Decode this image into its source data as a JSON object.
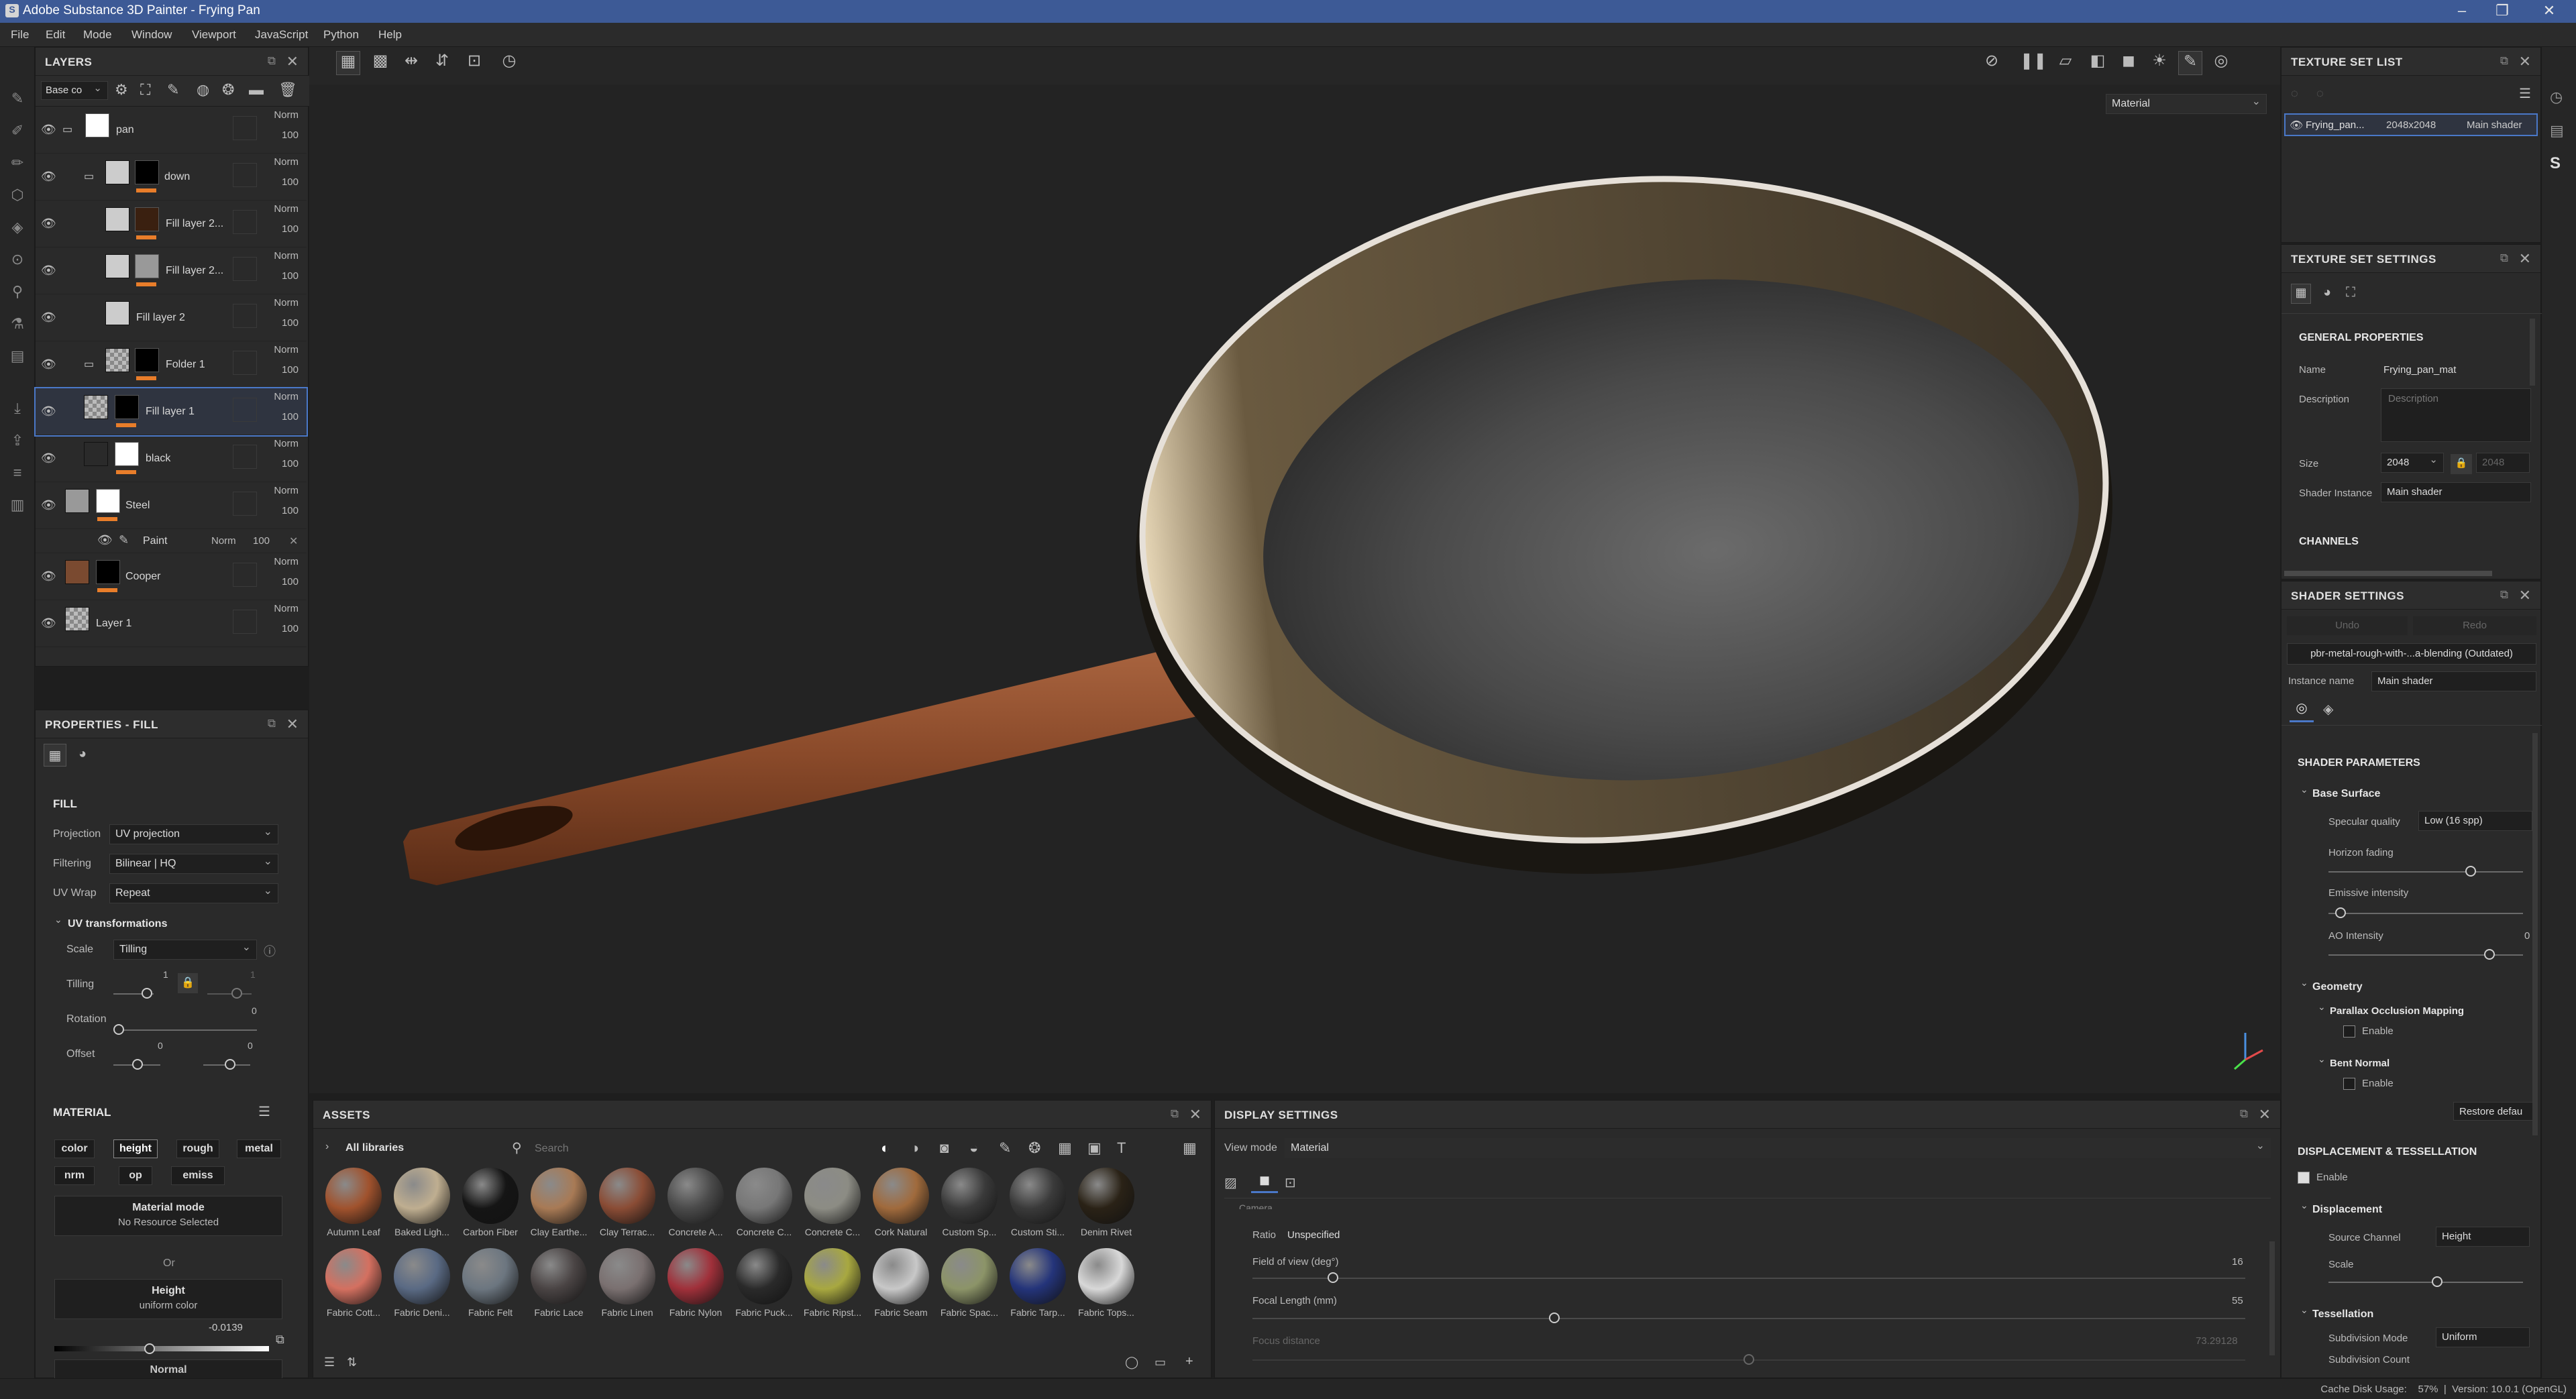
{
  "window": {
    "title": "Adobe Substance 3D Painter - Frying Pan"
  },
  "menu": [
    "File",
    "Edit",
    "Mode",
    "Window",
    "Viewport",
    "JavaScript",
    "Python",
    "Help"
  ],
  "layers": {
    "title": "LAYERS",
    "channel_select": "Base co",
    "items": [
      {
        "name": "pan",
        "blend": "Norm",
        "opacity": "100"
      },
      {
        "name": "down",
        "blend": "Norm",
        "opacity": "100"
      },
      {
        "name": "Fill layer 2...",
        "blend": "Norm",
        "opacity": "100"
      },
      {
        "name": "Fill layer 2...",
        "blend": "Norm",
        "opacity": "100"
      },
      {
        "name": "Fill layer 2",
        "blend": "Norm",
        "opacity": "100"
      },
      {
        "name": "Folder 1",
        "blend": "Norm",
        "opacity": "100"
      },
      {
        "name": "Fill layer 1",
        "blend": "Norm",
        "opacity": "100"
      },
      {
        "name": "black",
        "blend": "Norm",
        "opacity": "100"
      },
      {
        "name": "Steel",
        "blend": "Norm",
        "opacity": "100"
      },
      {
        "name": "Cooper",
        "blend": "Norm",
        "opacity": "100"
      },
      {
        "name": "Layer 1",
        "blend": "Norm",
        "opacity": "100"
      }
    ],
    "effect": {
      "name": "Paint",
      "blend": "Norm",
      "opacity": "100"
    }
  },
  "properties": {
    "title": "PROPERTIES - FILL",
    "section": "FILL",
    "projection_label": "Projection",
    "projection": "UV projection",
    "filtering_label": "Filtering",
    "filtering": "Bilinear | HQ",
    "uvwrap_label": "UV Wrap",
    "uvwrap": "Repeat",
    "uvtrans": "UV transformations",
    "scale_label": "Scale",
    "scale": "Tilling",
    "tilling_label": "Tilling",
    "tilling_v1": "1",
    "tilling_v2": "1",
    "rotation_label": "Rotation",
    "rotation_v": "0",
    "offset_label": "Offset",
    "offset_v1": "0",
    "offset_v2": "0",
    "material_title": "MATERIAL",
    "chips": [
      "color",
      "height",
      "rough",
      "metal",
      "nrm",
      "op",
      "emiss"
    ],
    "material_mode": "Material mode",
    "no_resource": "No Resource Selected",
    "or": "Or",
    "height": "Height",
    "uniform": "uniform color",
    "height_value": "-0.0139",
    "normal": "Normal"
  },
  "viewport": {
    "mode": "Material"
  },
  "assets": {
    "title": "ASSETS",
    "library": "All libraries",
    "search_placeholder": "Search",
    "row1": [
      {
        "name": "Autumn Leaf",
        "color": "#a0522d"
      },
      {
        "name": "Baked Ligh...",
        "color": "#bfae90"
      },
      {
        "name": "Carbon Fiber",
        "color": "#151515"
      },
      {
        "name": "Clay Earthe...",
        "color": "#a87a55"
      },
      {
        "name": "Clay Terrac...",
        "color": "#8a4c35"
      },
      {
        "name": "Concrete A...",
        "color": "#4a4a4a"
      },
      {
        "name": "Concrete C...",
        "color": "#777"
      },
      {
        "name": "Concrete C...",
        "color": "#8c8c84"
      },
      {
        "name": "Cork Natural",
        "color": "#a06a3c"
      },
      {
        "name": "Custom Sp...",
        "color": "#3a3a3a"
      },
      {
        "name": "Custom Sti...",
        "color": "#3a3a3a"
      },
      {
        "name": "Denim Rivet",
        "color": "#2a2216"
      }
    ],
    "row2": [
      {
        "name": "Fabric Cott...",
        "color": "#d47060"
      },
      {
        "name": "Fabric Deni...",
        "color": "#5a6a84"
      },
      {
        "name": "Fabric Felt",
        "color": "#6c7680"
      },
      {
        "name": "Fabric Lace",
        "color": "#4a4444"
      },
      {
        "name": "Fabric Linen",
        "color": "#7a7070"
      },
      {
        "name": "Fabric Nylon",
        "color": "#a0303a"
      },
      {
        "name": "Fabric Puck...",
        "color": "#2a2a2a"
      },
      {
        "name": "Fabric Ripst...",
        "color": "#a8a840"
      },
      {
        "name": "Fabric Seam",
        "color": "#c8c8c8"
      },
      {
        "name": "Fabric Spac...",
        "color": "#8c9468"
      },
      {
        "name": "Fabric Tarp...",
        "color": "#24347a"
      },
      {
        "name": "Fabric Tops...",
        "color": "#d8d8d8"
      }
    ]
  },
  "display": {
    "title": "DISPLAY SETTINGS",
    "view_mode_label": "View mode",
    "view_mode": "Material",
    "camera": "Camera",
    "ratio_label": "Ratio",
    "ratio": "Unspecified",
    "fov_label": "Field of view (deg°)",
    "fov": "16",
    "focal_label": "Focal Length (mm)",
    "focal": "55",
    "focus_label": "Focus distance",
    "focus": "73.29128"
  },
  "texture_set_list": {
    "title": "TEXTURE SET LIST",
    "name": "Frying_pan...",
    "res": "2048x2048",
    "shader": "Main shader"
  },
  "texture_set_settings": {
    "title": "TEXTURE SET SETTINGS",
    "general": "GENERAL PROPERTIES",
    "name_label": "Name",
    "name": "Frying_pan_mat",
    "desc_label": "Description",
    "desc_placeholder": "Description",
    "size_label": "Size",
    "size": "2048",
    "size2": "2048",
    "shader_label": "Shader Instance",
    "shader": "Main shader",
    "channels": "CHANNELS"
  },
  "shader_settings": {
    "title": "SHADER SETTINGS",
    "undo": "Undo",
    "redo": "Redo",
    "shader_name": "pbr-metal-rough-with-...a-blending (Outdated)",
    "instance_label": "Instance name",
    "instance": "Main shader",
    "params": "SHADER PARAMETERS",
    "base_surface": "Base Surface",
    "spec_label": "Specular quality",
    "spec": "Low (16 spp)",
    "horizon": "Horizon fading",
    "emissive": "Emissive intensity",
    "ao": "AO Intensity",
    "ao_value": "0",
    "geometry": "Geometry",
    "pom": "Parallax Occlusion Mapping",
    "enable": "Enable",
    "bent": "Bent Normal",
    "restore": "Restore defau",
    "disp_tess": "DISPLACEMENT & TESSELLATION",
    "displacement": "Displacement",
    "source_label": "Source Channel",
    "source": "Height",
    "scale": "Scale",
    "tessellation": "Tessellation",
    "subdiv_label": "Subdivision Mode",
    "subdiv": "Uniform",
    "subdiv_count": "Subdivision Count"
  },
  "status": {
    "text": "Cache Disk Usage:    57%  |  Version: 10.0.1 (OpenGL)"
  }
}
